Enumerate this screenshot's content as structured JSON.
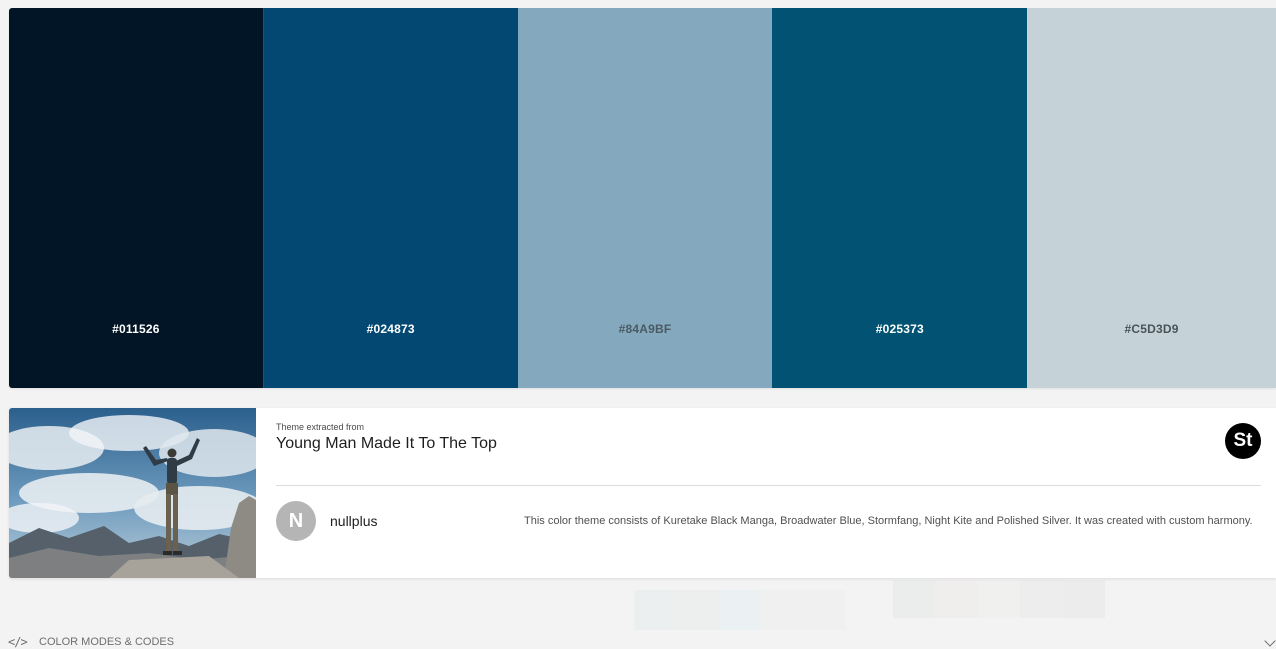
{
  "palette": {
    "swatches": [
      {
        "hex": "#011526",
        "label_color": "#ffffff"
      },
      {
        "hex": "#024873",
        "label_color": "#ffffff"
      },
      {
        "hex": "#84A9BF",
        "label_color": "#4a5a63"
      },
      {
        "hex": "#025373",
        "label_color": "#ffffff"
      },
      {
        "hex": "#C5D3D9",
        "label_color": "#4a5358"
      }
    ]
  },
  "theme": {
    "extracted_label": "Theme extracted from",
    "title": "Young Man Made It To The Top",
    "stock_badge": "St"
  },
  "author": {
    "avatar_initial": "N",
    "name": "nullplus"
  },
  "description": "This color theme consists of Kuretake Black Manga, Broadwater Blue, Stormfang, Night Kite and Polished Silver. It was created with custom harmony.",
  "footer": {
    "code_icon": "</>",
    "modes_label": "COLOR MODES & CODES",
    "chevron_icon": "chevron-down-icon"
  }
}
